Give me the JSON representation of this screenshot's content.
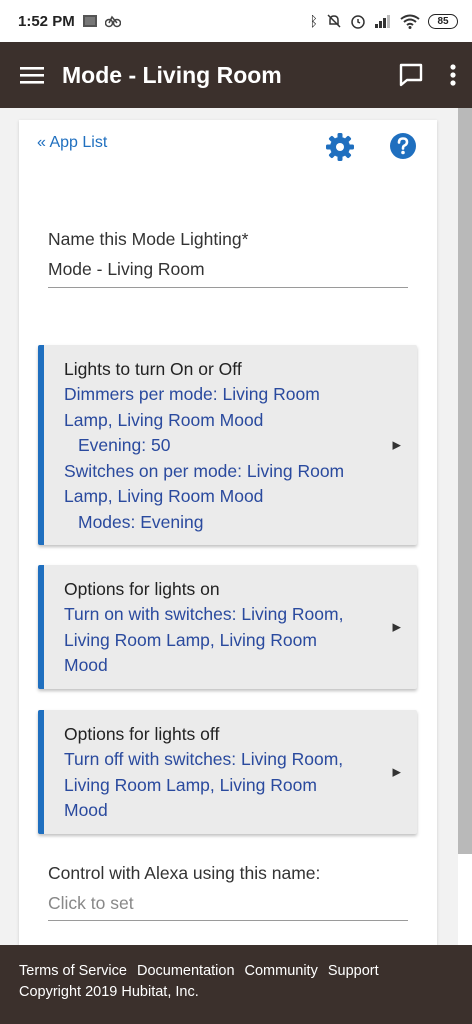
{
  "status_bar": {
    "time": "1:52 PM",
    "battery": "85"
  },
  "app_bar": {
    "title": "Mode - Living Room"
  },
  "nav": {
    "app_list": "« App List"
  },
  "name_field": {
    "label": "Name this Mode Lighting*",
    "value": "Mode - Living Room"
  },
  "cards": [
    {
      "title": "Lights to turn On or Off",
      "lines": [
        {
          "text": "Dimmers per mode: Living Room",
          "indent": false
        },
        {
          "text": "Lamp, Living Room Mood",
          "indent": false
        },
        {
          "text": "Evening: 50",
          "indent": true
        },
        {
          "text": "Switches on per mode: Living Room",
          "indent": false
        },
        {
          "text": "Lamp, Living Room Mood",
          "indent": false
        },
        {
          "text": "Modes: Evening",
          "indent": true
        }
      ]
    },
    {
      "title": "Options for lights on",
      "lines": [
        {
          "text": "Turn on with switches: Living Room,",
          "indent": false
        },
        {
          "text": "Living Room Lamp, Living Room",
          "indent": false
        },
        {
          "text": "Mood",
          "indent": false
        }
      ]
    },
    {
      "title": "Options for lights off",
      "lines": [
        {
          "text": "Turn off with switches: Living Room,",
          "indent": false
        },
        {
          "text": "Living Room Lamp, Living Room",
          "indent": false
        },
        {
          "text": "Mood",
          "indent": false
        }
      ]
    }
  ],
  "alexa_field": {
    "label": "Control with Alexa using this name:",
    "placeholder": "Click to set"
  },
  "footer": {
    "links": [
      "Terms of Service",
      "Documentation",
      "Community",
      "Support"
    ],
    "copyright": "Copyright 2019 Hubitat, Inc."
  },
  "colors": {
    "accent": "#1f6fbf",
    "header_bg": "#3b302c",
    "value_text": "#2a4a9e"
  }
}
